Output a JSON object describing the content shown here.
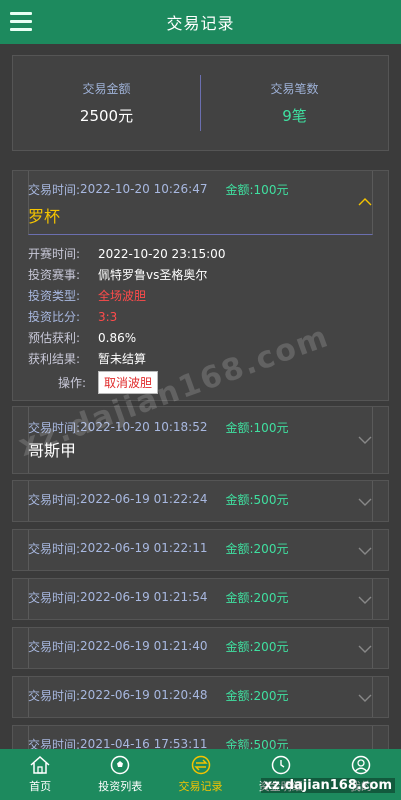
{
  "header": {
    "title": "交易记录",
    "menu_icon": "hamburger-menu-icon"
  },
  "summary": {
    "amount_label": "交易金额",
    "amount_value": "2500元",
    "count_label": "交易笔数",
    "count_value": "9笔"
  },
  "labels": {
    "trade_time": "交易时间:",
    "amount_prefix": "金额:"
  },
  "records": [
    {
      "time": "2022-10-20 10:26:47",
      "amount": "100元",
      "team": "罗杯",
      "expanded": true
    },
    {
      "time": "2022-10-20 10:18:52",
      "amount": "100元",
      "team": "哥斯甲",
      "expanded": false
    },
    {
      "time": "2022-06-19 01:22:24",
      "amount": "500元"
    },
    {
      "time": "2022-06-19 01:22:11",
      "amount": "200元"
    },
    {
      "time": "2022-06-19 01:21:54",
      "amount": "200元"
    },
    {
      "time": "2022-06-19 01:21:40",
      "amount": "200元"
    },
    {
      "time": "2022-06-19 01:20:48",
      "amount": "200元"
    },
    {
      "time": "2021-04-16 17:53:11",
      "amount": "500元"
    }
  ],
  "detail": {
    "start_time_label": "开赛时间:",
    "start_time": "2022-10-20 23:15:00",
    "match_label": "投资赛事:",
    "match": "佩特罗鲁vs圣格奥尔",
    "type_label": "投资类型:",
    "type": "全场波胆",
    "score_label": "投资比分:",
    "score": "3:3",
    "profit_label": "预估获利:",
    "profit": "0.86%",
    "result_label": "获利结果:",
    "result": "暂未结算",
    "action_label": "操作:",
    "action_button": "取消波胆"
  },
  "watermark": "xz.dajian168.com",
  "corner_watermark": "xz.dajian168.com",
  "bottom_nav": [
    {
      "label": "首页",
      "icon": "home-icon"
    },
    {
      "label": "投资列表",
      "icon": "soccer-ball-icon"
    },
    {
      "label": "交易记录",
      "icon": "transaction-record-icon",
      "active": true
    },
    {
      "label": "资金明细",
      "icon": "clock-icon"
    },
    {
      "label": "我的",
      "icon": "user-icon"
    }
  ],
  "colors": {
    "primary_green": "#1d8a5e",
    "accent_green": "#3fe0a0",
    "accent_yellow": "#f5c400",
    "danger_red": "#ff4b4b",
    "background": "#3b3b3b"
  }
}
